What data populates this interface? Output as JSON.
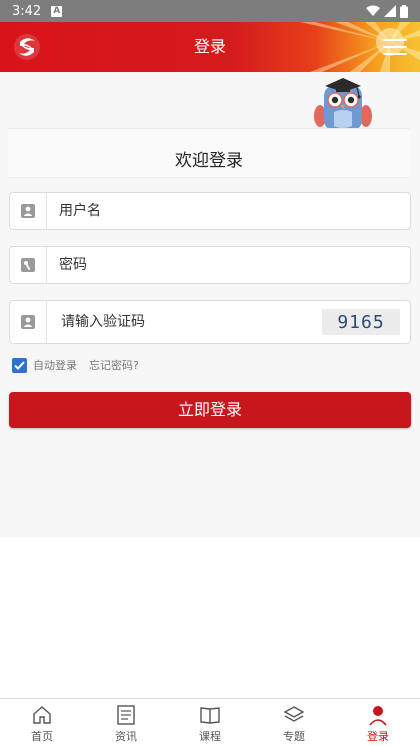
{
  "status_bar": {
    "time": "3:42",
    "notification_letter": "A"
  },
  "header": {
    "title": "登录"
  },
  "login": {
    "welcome": "欢迎登录",
    "username_placeholder": "用户名",
    "password_placeholder": "密码",
    "captcha_placeholder": "请输入验证码",
    "captcha_code": "9165",
    "remember_label": "自动登录",
    "remember_checked": true,
    "forgot_label": "忘记密码?",
    "submit_label": "立即登录"
  },
  "tabs": [
    {
      "label": "首页",
      "icon": "home-icon"
    },
    {
      "label": "资讯",
      "icon": "news-icon"
    },
    {
      "label": "课程",
      "icon": "book-icon"
    },
    {
      "label": "专题",
      "icon": "layers-icon"
    },
    {
      "label": "登录",
      "icon": "user-icon",
      "active": true
    }
  ],
  "colors": {
    "brand_red": "#c6171c",
    "accent_blue": "#2f73c9"
  }
}
